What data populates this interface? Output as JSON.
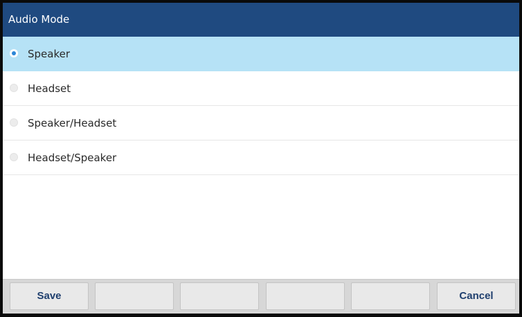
{
  "title": "Audio Mode",
  "options": [
    {
      "label": "Speaker",
      "selected": true
    },
    {
      "label": "Headset",
      "selected": false
    },
    {
      "label": "Speaker/Headset",
      "selected": false
    },
    {
      "label": "Headset/Speaker",
      "selected": false
    }
  ],
  "softkeys": {
    "save": "Save",
    "key2": "",
    "key3": "",
    "key4": "",
    "key5": "",
    "cancel": "Cancel"
  },
  "colors": {
    "title_bar": "#1f4a80",
    "selected_row": "#b6e2f6",
    "radio_dot": "#2d86d6",
    "softkey_text": "#1f3f6e"
  }
}
